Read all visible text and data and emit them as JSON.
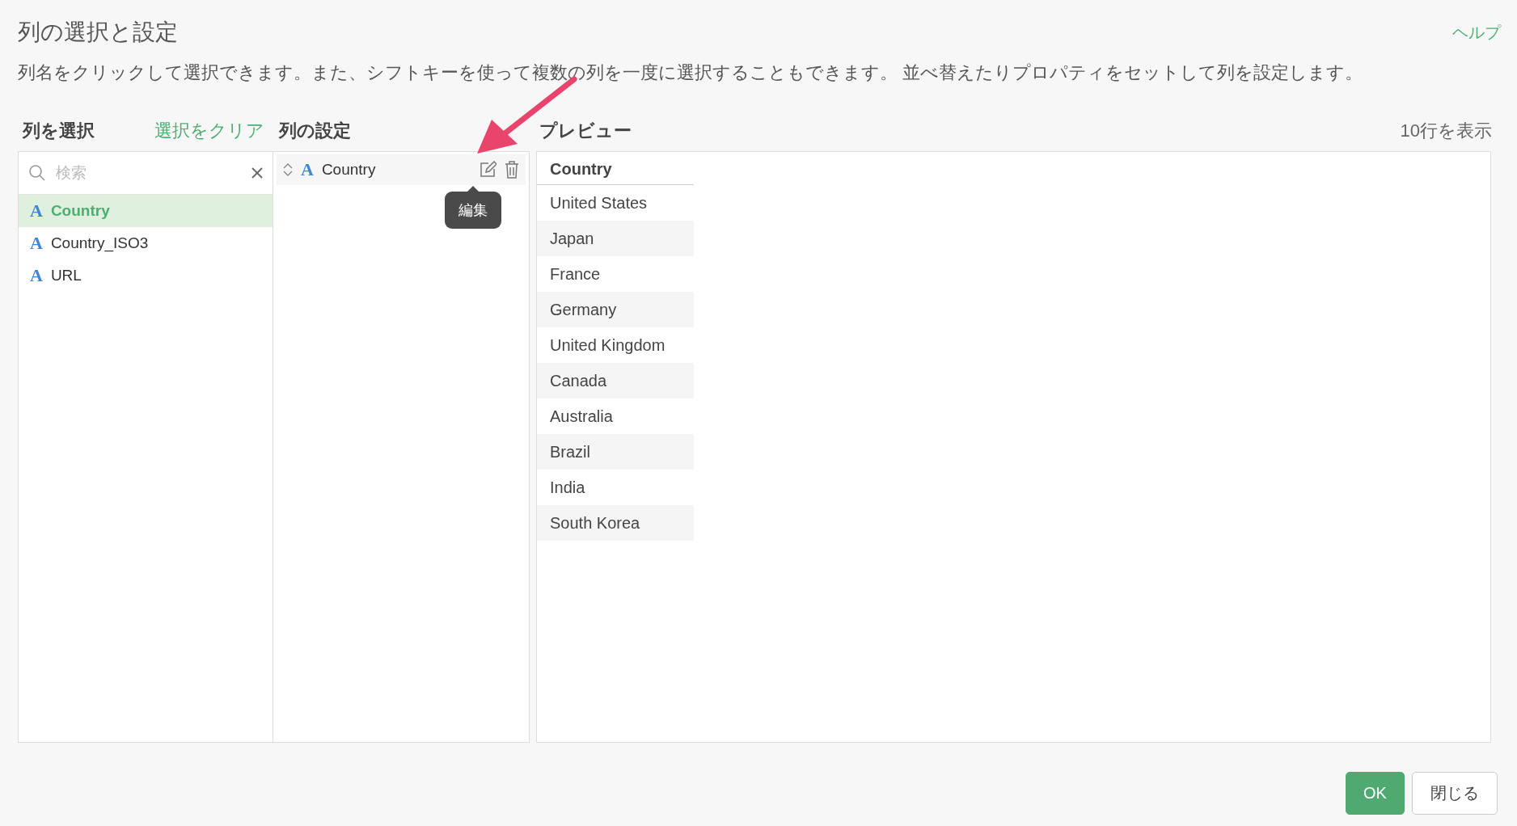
{
  "dialog": {
    "title": "列の選択と設定",
    "help_link": "ヘルプ",
    "description": "列名をクリックして選択できます。また、シフトキーを使って複数の列を一度に選択することもできます。 並べ替えたりプロパティをセットして列を設定します。"
  },
  "column_picker": {
    "heading": "列を選択",
    "clear_link": "選択をクリア",
    "search": {
      "placeholder": "検索"
    },
    "items": [
      {
        "type_icon": "A",
        "name": "Country",
        "selected": true
      },
      {
        "type_icon": "A",
        "name": "Country_ISO3",
        "selected": false
      },
      {
        "type_icon": "A",
        "name": "URL",
        "selected": false
      }
    ]
  },
  "column_settings": {
    "heading": "列の設定",
    "items": [
      {
        "type_icon": "A",
        "name": "Country"
      }
    ],
    "tooltip": "編集"
  },
  "preview": {
    "heading": "プレビュー",
    "row_count": "10行を表示",
    "columns": [
      "Country"
    ],
    "rows": [
      [
        "United States"
      ],
      [
        "Japan"
      ],
      [
        "France"
      ],
      [
        "Germany"
      ],
      [
        "United Kingdom"
      ],
      [
        "Canada"
      ],
      [
        "Australia"
      ],
      [
        "Brazil"
      ],
      [
        "India"
      ],
      [
        "South Korea"
      ]
    ]
  },
  "buttons": [
    {
      "label": "OK",
      "kind": "primary"
    },
    {
      "label": "閉じる",
      "kind": "default"
    }
  ]
}
